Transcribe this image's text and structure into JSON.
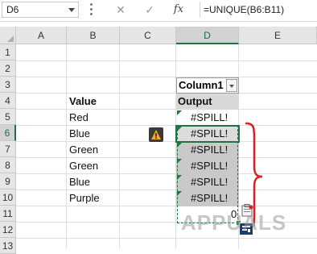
{
  "formula_bar": {
    "name_box": "D6",
    "cancel_symbol": "✕",
    "enter_symbol": "✓",
    "fx_label": "fx",
    "formula": "=UNIQUE(B6:B11)"
  },
  "columns": [
    "A",
    "B",
    "C",
    "D",
    "E"
  ],
  "rows": [
    "1",
    "2",
    "3",
    "4",
    "5",
    "6",
    "7",
    "8",
    "9",
    "10",
    "11",
    "12",
    "13"
  ],
  "selected_column": "D",
  "selected_row": "6",
  "cells": {
    "table_header": "Column1",
    "value_header": "Value",
    "output_header": "Output",
    "values": [
      "Red",
      "Blue",
      "Green",
      "Green",
      "Blue",
      "Purple"
    ],
    "outputs": [
      "#SPILL!",
      "#SPILL!",
      "#SPILL!",
      "#SPILL!",
      "#SPILL!",
      "#SPILL!"
    ],
    "d11": "0"
  },
  "icons": {
    "error_indicator": "warning-icon",
    "table_filter": "chevron-down-icon",
    "paste_options": "clipboard-icon",
    "quick_analysis": "quick-analysis-icon"
  },
  "watermark": "APPUALS",
  "colors": {
    "accent_green": "#217346",
    "brace_red": "#e02020",
    "spill_gray": "#c9c9c9"
  }
}
